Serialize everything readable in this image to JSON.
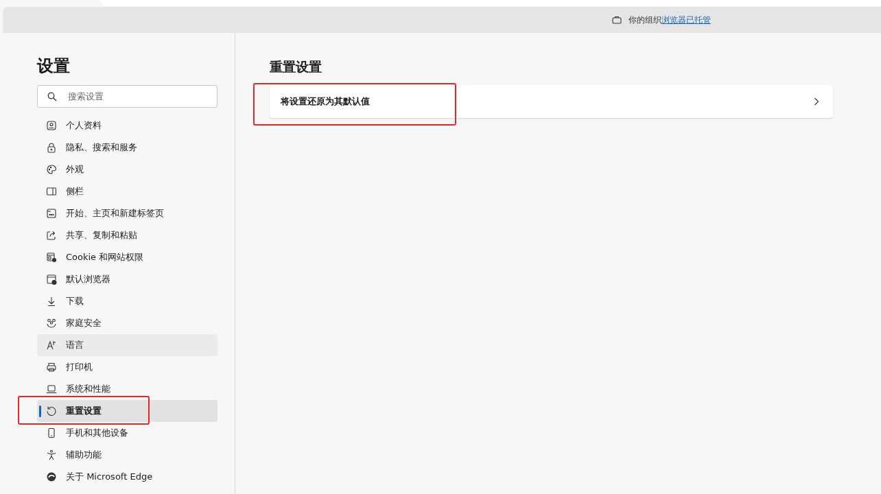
{
  "banner": {
    "text": "你的组织",
    "link": "浏览器已托管"
  },
  "sidebar": {
    "title": "设置",
    "search": {
      "placeholder": "搜索设置"
    },
    "items": [
      {
        "kind": "profile",
        "label": "个人资料",
        "selected": false,
        "hovered": false,
        "highlighted": false
      },
      {
        "kind": "lock",
        "label": "隐私、搜索和服务",
        "selected": false,
        "hovered": false,
        "highlighted": false
      },
      {
        "kind": "palette",
        "label": "外观",
        "selected": false,
        "hovered": false,
        "highlighted": false
      },
      {
        "kind": "sidebar",
        "label": "侧栏",
        "selected": false,
        "hovered": false,
        "highlighted": false
      },
      {
        "kind": "home",
        "label": "开始、主页和新建标签页",
        "selected": false,
        "hovered": false,
        "highlighted": false
      },
      {
        "kind": "share",
        "label": "共享、复制和粘贴",
        "selected": false,
        "hovered": false,
        "highlighted": false
      },
      {
        "kind": "cookie",
        "label": "Cookie 和网站权限",
        "selected": false,
        "hovered": false,
        "highlighted": false
      },
      {
        "kind": "browser",
        "label": "默认浏览器",
        "selected": false,
        "hovered": false,
        "highlighted": false
      },
      {
        "kind": "download",
        "label": "下载",
        "selected": false,
        "hovered": false,
        "highlighted": false
      },
      {
        "kind": "family",
        "label": "家庭安全",
        "selected": false,
        "hovered": false,
        "highlighted": false
      },
      {
        "kind": "language",
        "label": "语言",
        "selected": false,
        "hovered": true,
        "highlighted": false
      },
      {
        "kind": "printer",
        "label": "打印机",
        "selected": false,
        "hovered": false,
        "highlighted": false
      },
      {
        "kind": "laptop",
        "label": "系统和性能",
        "selected": false,
        "hovered": false,
        "highlighted": false
      },
      {
        "kind": "reset",
        "label": "重置设置",
        "selected": true,
        "hovered": false,
        "highlighted": true
      },
      {
        "kind": "phone",
        "label": "手机和其他设备",
        "selected": false,
        "hovered": false,
        "highlighted": false
      },
      {
        "kind": "accessibility",
        "label": "辅助功能",
        "selected": false,
        "hovered": false,
        "highlighted": false
      },
      {
        "kind": "edge",
        "label": "关于 Microsoft Edge",
        "selected": false,
        "hovered": false,
        "highlighted": false
      }
    ]
  },
  "main": {
    "title": "重置设置",
    "rows": [
      {
        "label": "将设置还原为其默认值",
        "highlighted": true
      }
    ]
  }
}
